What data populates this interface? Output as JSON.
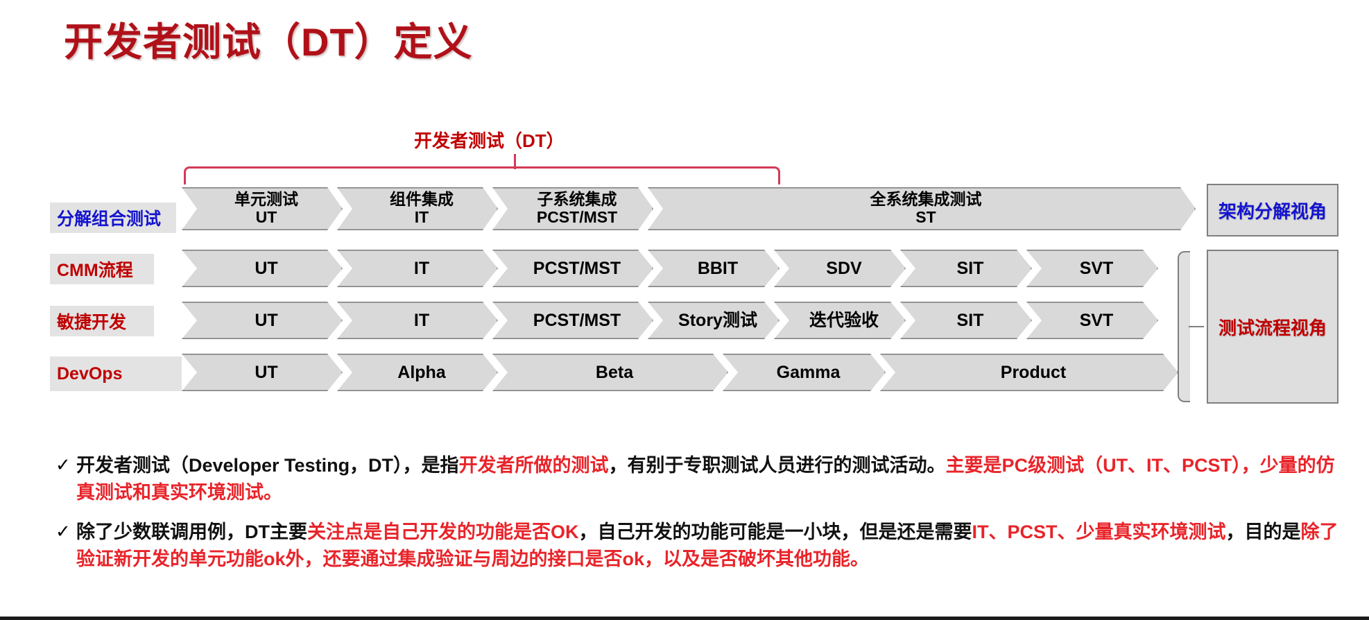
{
  "slide": {
    "title": "开发者测试（DT）定义"
  },
  "diagram": {
    "dt_bracket_label": "开发者测试（DT）",
    "rows": [
      {
        "label": "分解组合测试",
        "label_color": "#1414cf",
        "stages": [
          {
            "top": "单元测试",
            "sub": "UT"
          },
          {
            "top": "组件集成",
            "sub": "IT"
          },
          {
            "top": "子系统集成",
            "sub": "PCST/MST"
          },
          {
            "top": "全系统集成测试",
            "sub": "ST"
          }
        ]
      },
      {
        "label": "CMM流程",
        "label_color": "#c00000",
        "stages": [
          {
            "top": "UT",
            "sub": ""
          },
          {
            "top": "IT",
            "sub": ""
          },
          {
            "top": "PCST/MST",
            "sub": ""
          },
          {
            "top": "BBIT",
            "sub": ""
          },
          {
            "top": "SDV",
            "sub": ""
          },
          {
            "top": "SIT",
            "sub": ""
          },
          {
            "top": "SVT",
            "sub": ""
          }
        ]
      },
      {
        "label": "敏捷开发",
        "label_color": "#c00000",
        "stages": [
          {
            "top": "UT",
            "sub": ""
          },
          {
            "top": "IT",
            "sub": ""
          },
          {
            "top": "PCST/MST",
            "sub": ""
          },
          {
            "top": "Story测试",
            "sub": ""
          },
          {
            "top": "迭代验收",
            "sub": ""
          },
          {
            "top": "SIT",
            "sub": ""
          },
          {
            "top": "SVT",
            "sub": ""
          }
        ]
      },
      {
        "label": "DevOps",
        "label_color": "#c00000",
        "stages": [
          {
            "top": "UT",
            "sub": ""
          },
          {
            "top": "Alpha",
            "sub": ""
          },
          {
            "top": "Beta",
            "sub": ""
          },
          {
            "top": "Gamma",
            "sub": ""
          },
          {
            "top": "Product",
            "sub": ""
          }
        ]
      }
    ],
    "views": {
      "architecture": "架构分解视角",
      "process": "测试流程视角"
    }
  },
  "bullets": [
    {
      "marker": "✓",
      "segments": [
        {
          "text": "开发者测试（Developer Testing，DT），是指",
          "color": "black"
        },
        {
          "text": "开发者所做的测试",
          "color": "red"
        },
        {
          "text": "，有别于专职测试人员进行的测试活动。",
          "color": "black"
        },
        {
          "text": "主要是PC级测试（UT、IT、PCST），少量的仿真测试和真实环境测试。",
          "color": "red"
        }
      ]
    },
    {
      "marker": "✓",
      "segments": [
        {
          "text": "除了少数联调用例，DT主要",
          "color": "black"
        },
        {
          "text": "关注点是",
          "color": "red"
        },
        {
          "text": "自己开发的功能是否OK",
          "color": "red"
        },
        {
          "text": "，自己开发的功能可能是一小块，但是还是需要",
          "color": "black"
        },
        {
          "text": "IT、PCST、少量真实环境测试",
          "color": "red"
        },
        {
          "text": "，目的是",
          "color": "black"
        },
        {
          "text": "除了验证新开发的单元功能ok外，还要通过集成验证与周边的接口是否ok，以及是否破坏其他功能。",
          "color": "red"
        }
      ]
    }
  ],
  "colors": {
    "title_red": "#b01119",
    "accent_red": "#c00000",
    "bright_red": "#e8242a",
    "blue": "#1414cf",
    "chevron_fill": "#d9d9d9",
    "chevron_border": "#7f7f7f",
    "label_bg": "#e3e3e3"
  }
}
